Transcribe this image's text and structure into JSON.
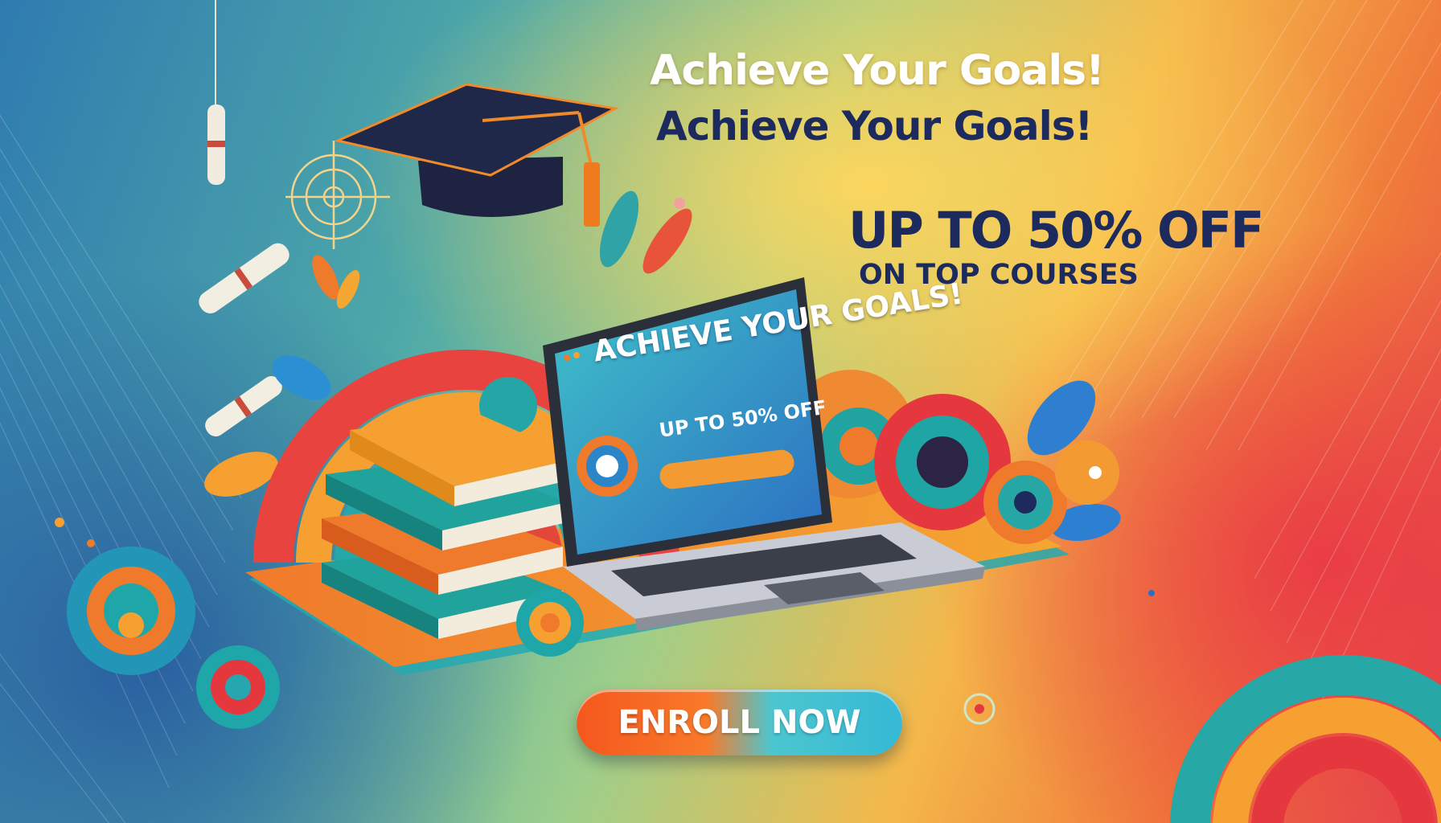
{
  "banner": {
    "headline_primary": "Achieve Your Goals!",
    "headline_secondary": "Achieve Your Goals!",
    "promo_line1": "UP TO 50% OFF",
    "promo_line2": "ON TOP COURSES",
    "cta_label": "ENROLL NOW"
  },
  "laptop_screen": {
    "title": "ACHIEVE YOUR GOALS!",
    "subtitle": "UP TO 50% OFF"
  },
  "colors": {
    "navy_text": "#1c2a5e",
    "orange": "#f5571e",
    "teal": "#35b9d6",
    "red": "#e5424d",
    "yellow": "#f4b84a"
  },
  "icons": [
    "graduation-cap-icon",
    "target-icon",
    "diploma-scroll-icon",
    "book-icon",
    "laptop-icon",
    "leaf-icon"
  ]
}
